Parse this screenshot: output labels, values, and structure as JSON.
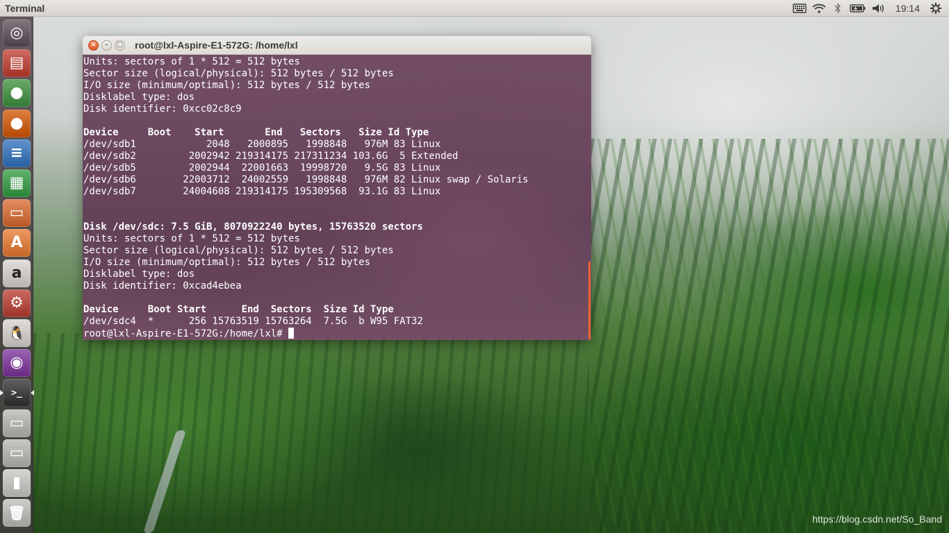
{
  "top_panel": {
    "app_title": "Terminal",
    "clock": "19:14",
    "indicators": [
      "keyboard-icon",
      "wifi-icon",
      "bluetooth-icon",
      "battery-icon",
      "volume-icon",
      "settings-gear-icon"
    ]
  },
  "launcher": {
    "items": [
      {
        "name": "ubuntu-dash-icon",
        "color": "#5a4a55",
        "glyph": "◎"
      },
      {
        "name": "files-icon",
        "color": "#c0392b",
        "glyph": "▤"
      },
      {
        "name": "chrome-icon",
        "color": "#3b8f3a",
        "glyph": "●"
      },
      {
        "name": "firefox-icon",
        "color": "#d35400",
        "glyph": "●"
      },
      {
        "name": "writer-icon",
        "color": "#2c6fbd",
        "glyph": "≡"
      },
      {
        "name": "calc-icon",
        "color": "#2e9a3e",
        "glyph": "▦"
      },
      {
        "name": "impress-icon",
        "color": "#d9682b",
        "glyph": "▭"
      },
      {
        "name": "software-center-icon",
        "color": "#e8772e",
        "glyph": "A"
      },
      {
        "name": "amazon-icon",
        "color": "#d8d4cf",
        "glyph": "a"
      },
      {
        "name": "system-settings-icon",
        "color": "#b83a2e",
        "glyph": "⚙"
      },
      {
        "name": "linux-penguin-icon",
        "color": "#d7d2cc",
        "glyph": "🐧"
      },
      {
        "name": "purple-app-icon",
        "color": "#7a2f9a",
        "glyph": "◉"
      },
      {
        "name": "terminal-icon",
        "color": "#2d2d2d",
        "glyph": ">_"
      },
      {
        "name": "disk-drive-icon",
        "color": "#b8b6b2",
        "glyph": "▭"
      },
      {
        "name": "disk-drive-icon-2",
        "color": "#b8b6b2",
        "glyph": "▭"
      },
      {
        "name": "usb-drive-icon",
        "color": "#c9c7c3",
        "glyph": "▮"
      },
      {
        "name": "trash-icon",
        "color": "#bdbbb7",
        "glyph": "🗑"
      }
    ]
  },
  "window": {
    "title": "root@lxl-Aspire-E1-572G: /home/lxl",
    "buttons": {
      "close": "×",
      "minimize": "–",
      "maximize": "□"
    }
  },
  "terminal": {
    "lines": [
      {
        "text": "Units: sectors of 1 * 512 = 512 bytes",
        "bold": false
      },
      {
        "text": "Sector size (logical/physical): 512 bytes / 512 bytes",
        "bold": false
      },
      {
        "text": "I/O size (minimum/optimal): 512 bytes / 512 bytes",
        "bold": false
      },
      {
        "text": "Disklabel type: dos",
        "bold": false
      },
      {
        "text": "Disk identifier: 0xcc02c8c9",
        "bold": false
      },
      {
        "text": "",
        "bold": false
      },
      {
        "text": "Device     Boot    Start       End   Sectors   Size Id Type",
        "bold": true
      },
      {
        "text": "/dev/sdb1            2048   2000895   1998848   976M 83 Linux",
        "bold": false
      },
      {
        "text": "/dev/sdb2         2002942 219314175 217311234 103.6G  5 Extended",
        "bold": false
      },
      {
        "text": "/dev/sdb5         2002944  22001663  19998720   9.5G 83 Linux",
        "bold": false
      },
      {
        "text": "/dev/sdb6        22003712  24002559   1998848   976M 82 Linux swap / Solaris",
        "bold": false
      },
      {
        "text": "/dev/sdb7        24004608 219314175 195309568  93.1G 83 Linux",
        "bold": false
      },
      {
        "text": "",
        "bold": false
      },
      {
        "text": "",
        "bold": false
      },
      {
        "text": "Disk /dev/sdc: 7.5 GiB, 8070922240 bytes, 15763520 sectors",
        "bold": true
      },
      {
        "text": "Units: sectors of 1 * 512 = 512 bytes",
        "bold": false
      },
      {
        "text": "Sector size (logical/physical): 512 bytes / 512 bytes",
        "bold": false
      },
      {
        "text": "I/O size (minimum/optimal): 512 bytes / 512 bytes",
        "bold": false
      },
      {
        "text": "Disklabel type: dos",
        "bold": false
      },
      {
        "text": "Disk identifier: 0xcad4ebea",
        "bold": false
      },
      {
        "text": "",
        "bold": false
      },
      {
        "text": "Device     Boot Start      End  Sectors  Size Id Type",
        "bold": true
      },
      {
        "text": "/dev/sdc4  *      256 15763519 15763264  7.5G  b W95 FAT32",
        "bold": false
      }
    ],
    "prompt": "root@lxl-Aspire-E1-572G:/home/lxl# "
  },
  "watermark": "https://blog.csdn.net/So_Band",
  "colors": {
    "terminal_bg": "#6a425c",
    "accent_orange": "#e8672e",
    "panel_bg": "#dfdcd8"
  }
}
